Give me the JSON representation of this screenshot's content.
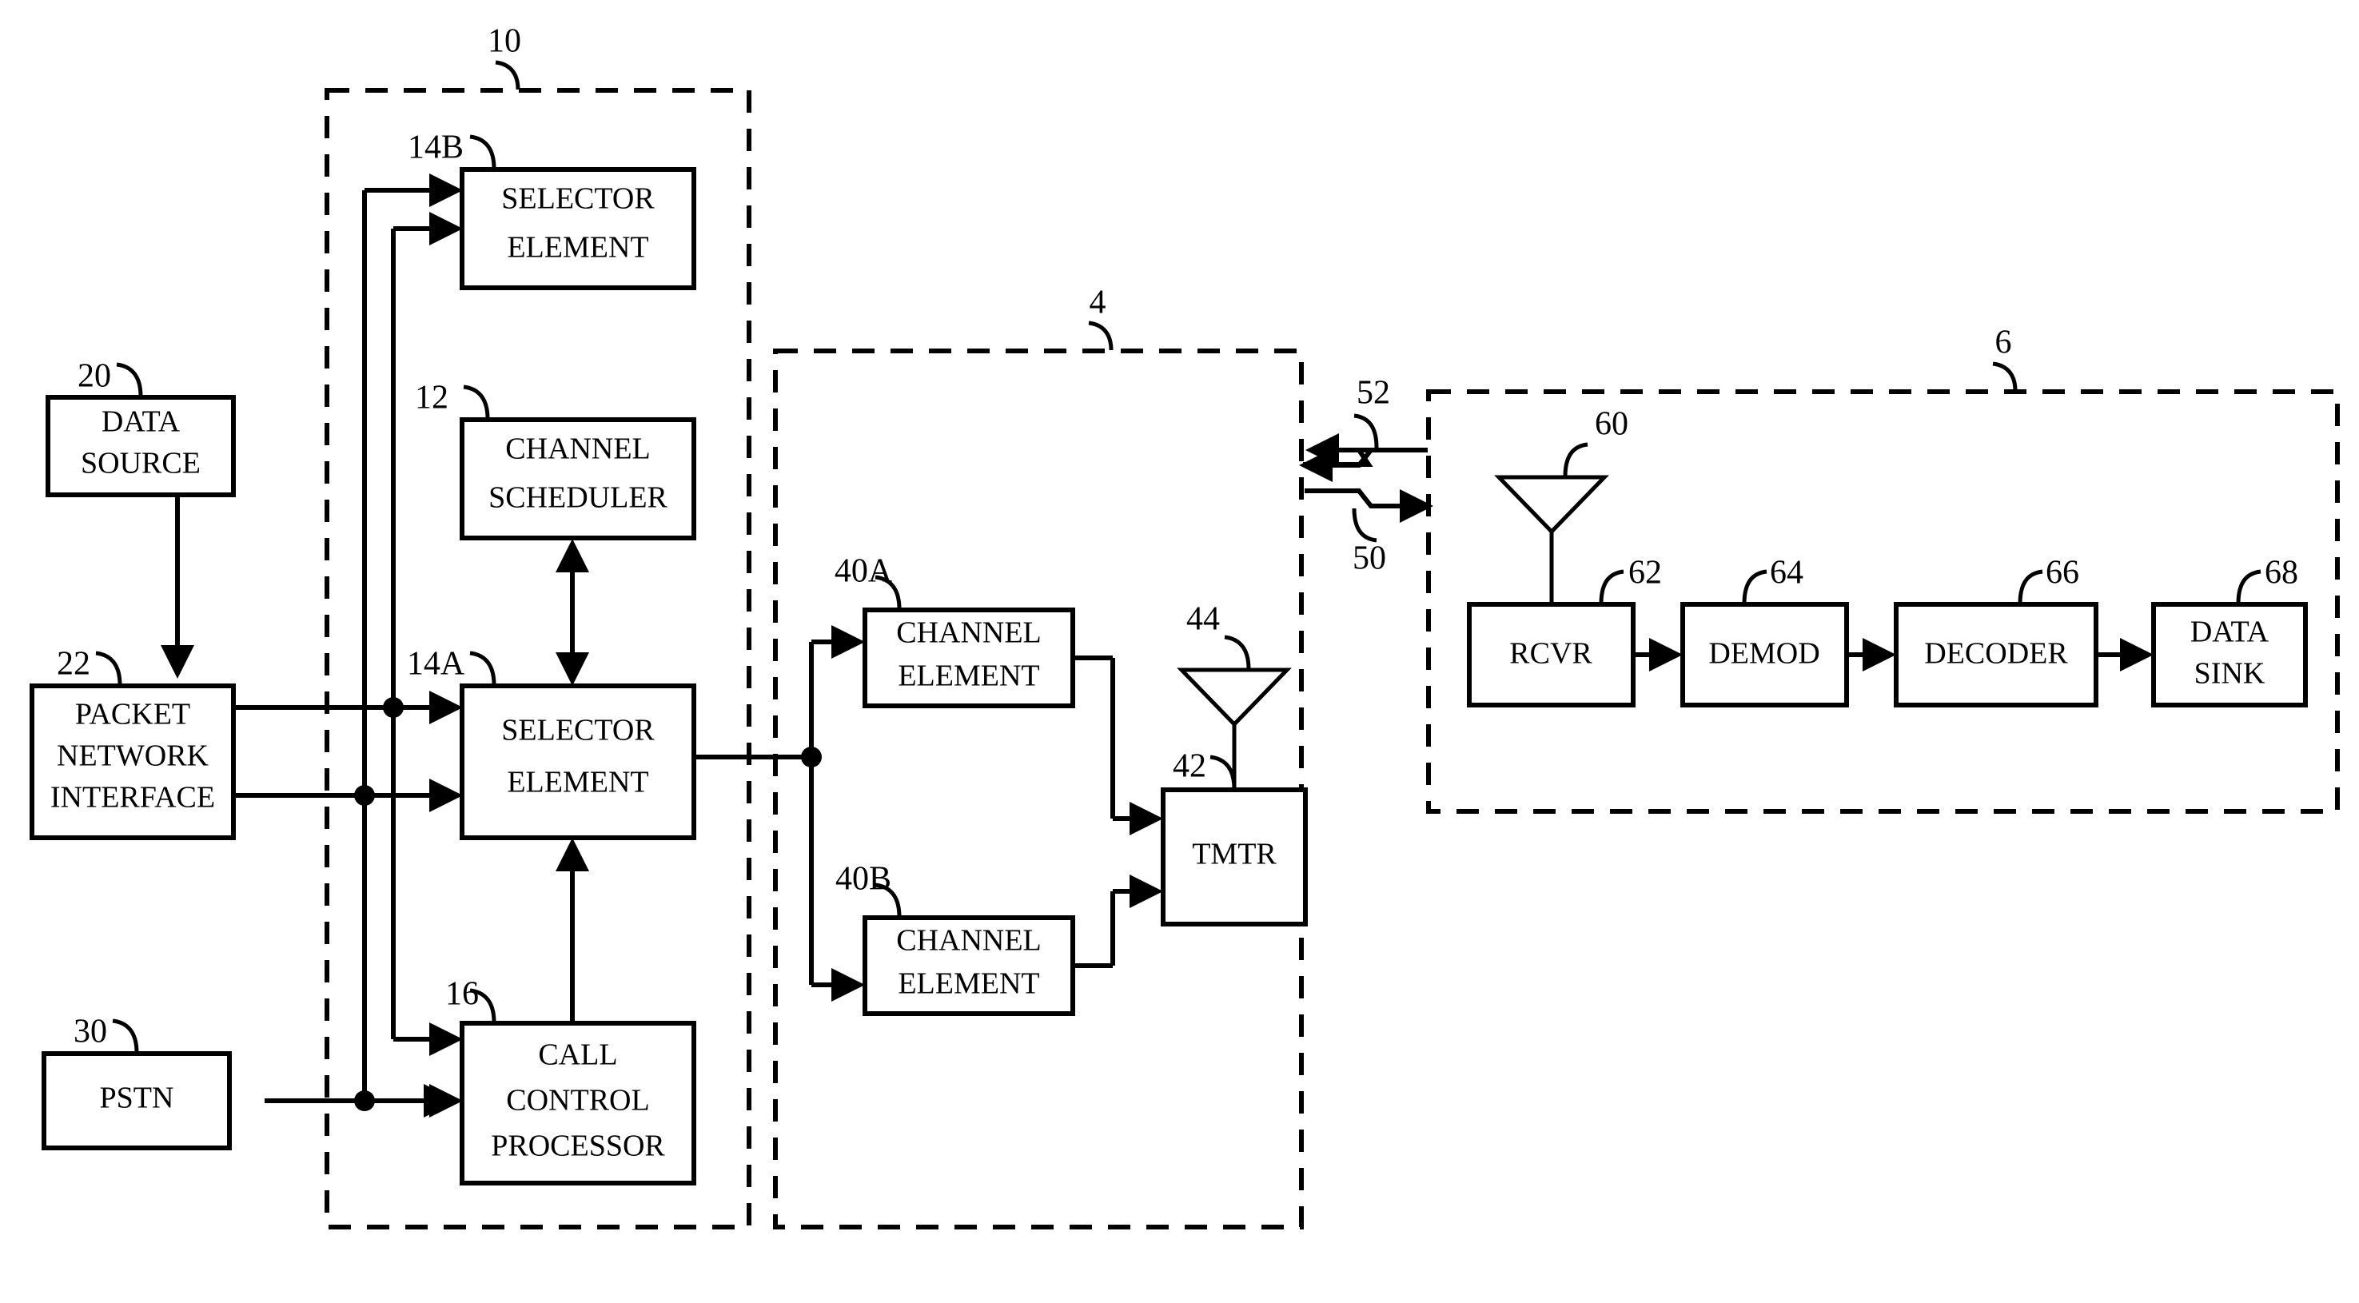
{
  "figure": {
    "type": "patent-block-diagram",
    "title": "Wireless communication system block diagram",
    "background_color": "#ffffff",
    "line_color": "#000000"
  },
  "groups": [
    {
      "id": "g10",
      "ref": "10",
      "name": "base-station-controller-group"
    },
    {
      "id": "g4",
      "ref": "4",
      "name": "base-station-group"
    },
    {
      "id": "g6",
      "ref": "6",
      "name": "remote-station-group"
    }
  ],
  "blocks": {
    "selector_element_b": {
      "ref": "14B",
      "line1": "SELECTOR",
      "line2": "ELEMENT"
    },
    "channel_scheduler": {
      "ref": "12",
      "line1": "CHANNEL",
      "line2": "SCHEDULER"
    },
    "selector_element_a": {
      "ref": "14A",
      "line1": "SELECTOR",
      "line2": "ELEMENT"
    },
    "call_control_processor": {
      "ref": "16",
      "line1": "CALL",
      "line2": "CONTROL",
      "line3": "PROCESSOR"
    },
    "data_source": {
      "ref": "20",
      "line1": "DATA",
      "line2": "SOURCE"
    },
    "packet_network_interface": {
      "ref": "22",
      "line1": "PACKET",
      "line2": "NETWORK",
      "line3": "INTERFACE"
    },
    "pstn": {
      "ref": "30",
      "line1": "PSTN"
    },
    "channel_element_a": {
      "ref": "40A",
      "line1": "CHANNEL",
      "line2": "ELEMENT"
    },
    "channel_element_b": {
      "ref": "40B",
      "line1": "CHANNEL",
      "line2": "ELEMENT"
    },
    "transmitter": {
      "ref": "42",
      "line1": "TMTR"
    },
    "transmit_antenna": {
      "ref": "44",
      "name": "antenna-icon"
    },
    "receive_antenna": {
      "ref": "60",
      "name": "antenna-icon"
    },
    "receiver": {
      "ref": "62",
      "line1": "RCVR"
    },
    "demodulator": {
      "ref": "64",
      "line1": "DEMOD"
    },
    "decoder": {
      "ref": "66",
      "line1": "DECODER"
    },
    "data_sink": {
      "ref": "68",
      "line1": "DATA",
      "line2": "SINK"
    }
  },
  "links": {
    "reverse_link": {
      "ref": "52",
      "name": "reverse-wireless-link"
    },
    "forward_link": {
      "ref": "50",
      "name": "forward-wireless-link"
    }
  }
}
